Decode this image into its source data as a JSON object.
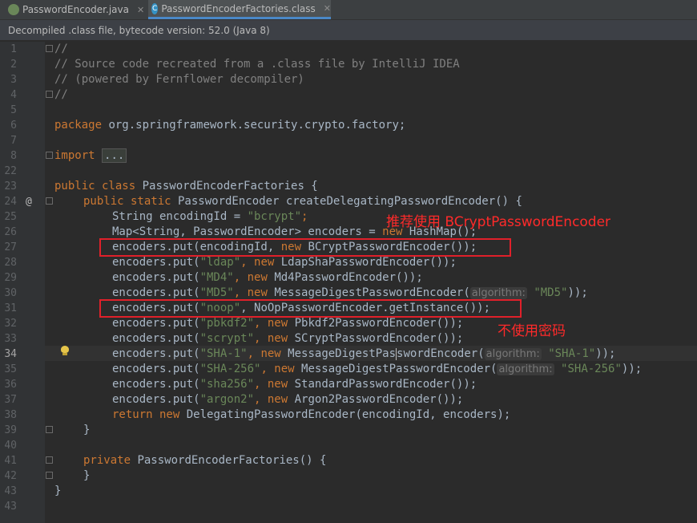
{
  "tabs": [
    {
      "label": "PasswordEncoder.java",
      "icon": "java-class-icon"
    },
    {
      "label": "PasswordEncoderFactories.class",
      "icon": "class-file-icon",
      "active": true
    }
  ],
  "banner": "Decompiled .class file, bytecode version: 52.0 (Java 8)",
  "line_numbers": [
    "1",
    "2",
    "3",
    "4",
    "5",
    "6",
    "7",
    "8",
    "22",
    "23",
    "24",
    "25",
    "26",
    "27",
    "28",
    "29",
    "30",
    "31",
    "32",
    "33",
    "34",
    "35",
    "36",
    "37",
    "38",
    "39",
    "40",
    "41",
    "42",
    "43"
  ],
  "code": {
    "l1": "//",
    "l2": "// Source code recreated from a .class file by IntelliJ IDEA",
    "l3": "// (powered by Fernflower decompiler)",
    "l4": "//",
    "l6_kw": "package",
    "l6_rest": " org.springframework.security.crypto.factory;",
    "l8_kw": "import",
    "l8_fold": "...",
    "l22_kw": "public class",
    "l22_rest": " PasswordEncoderFactories {",
    "l23_kw": "public static",
    "l23_rest": " PasswordEncoder createDelegatingPasswordEncoder() {",
    "l24_a": "String encodingId = ",
    "l24_s": "\"bcrypt\"",
    "l24_b": ";",
    "l25_a": "Map<String, PasswordEncoder> encoders = ",
    "l25_kw": "new",
    "l25_b": " HashMap();",
    "l26_a": "encoders.put(encodingId, ",
    "l26_kw": "new",
    "l26_b": " BCryptPasswordEncoder());",
    "l27_a": "encoders.put(",
    "l27_s": "\"ldap\"",
    "l27_kw": ", new",
    "l27_b": " LdapShaPasswordEncoder());",
    "l28_a": "encoders.put(",
    "l28_s": "\"MD4\"",
    "l28_kw": ", new",
    "l28_b": " Md4PasswordEncoder());",
    "l29_a": "encoders.put(",
    "l29_s": "\"MD5\"",
    "l29_kw": ", new",
    "l29_b": " MessageDigestPasswordEncoder(",
    "l29_hint": "algorithm:",
    "l29_s2": "\"MD5\"",
    "l29_c": "));",
    "l30_a": "encoders.put(",
    "l30_s": "\"noop\"",
    "l30_b": ", NoOpPasswordEncoder.getInstance());",
    "l31_a": "encoders.put(",
    "l31_s": "\"pbkdf2\"",
    "l31_kw": ", new",
    "l31_b": " Pbkdf2PasswordEncoder());",
    "l32_a": "encoders.put(",
    "l32_s": "\"scrypt\"",
    "l32_kw": ", new",
    "l32_b": " SCryptPasswordEncoder());",
    "l33_a": "encoders.put(",
    "l33_s": "\"SHA-1\"",
    "l33_kw": ", new",
    "l33_b1": " MessageDigestPas",
    "l33_b2": "swordEncoder(",
    "l33_hint": "algorithm:",
    "l33_s2": "\"SHA-1\"",
    "l33_c": "));",
    "l34_a": "encoders.put(",
    "l34_s": "\"SHA-256\"",
    "l34_kw": ", new",
    "l34_b": " MessageDigestPasswordEncoder(",
    "l34_hint": "algorithm:",
    "l34_s2": "\"SHA-256\"",
    "l34_c": "));",
    "l35_a": "encoders.put(",
    "l35_s": "\"sha256\"",
    "l35_kw": ", new",
    "l35_b": " StandardPasswordEncoder());",
    "l36_a": "encoders.put(",
    "l36_s": "\"argon2\"",
    "l36_kw": ", new",
    "l36_b": " Argon2PasswordEncoder());",
    "l37_kw": "return new",
    "l37_b": " DelegatingPasswordEncoder(encodingId, encoders);",
    "l38": "}",
    "l40_kw": "private",
    "l40_b": " PasswordEncoderFactories() {",
    "l41": "}",
    "l42": "}"
  },
  "annotations": {
    "recommend": "推荐使用 BCryptPasswordEncoder",
    "no_password": "不使用密码"
  },
  "gutter_mark": "@"
}
